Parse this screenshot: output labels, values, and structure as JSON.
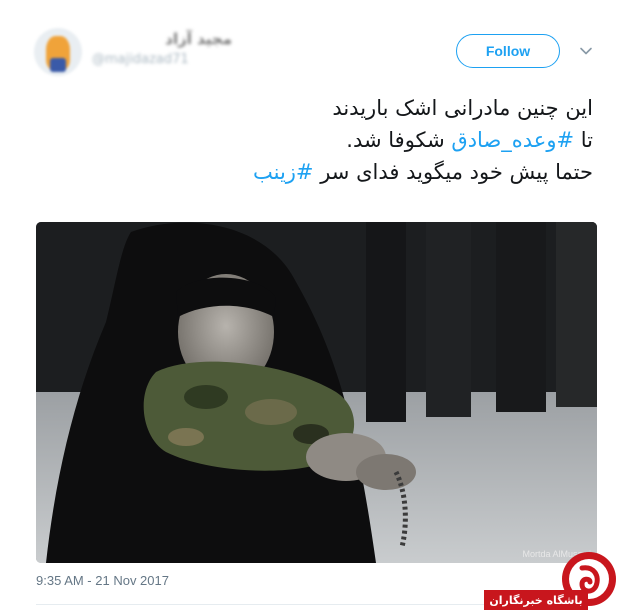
{
  "tweet": {
    "display_name": "مجید آزاد",
    "handle": "@majidazad71",
    "follow_label": "Follow",
    "text_line1": "این چنین مادرانی اشک باریدند",
    "text_line2_prefix": "تا ",
    "text_line2_hashtag": "#وعده_صادق",
    "text_line2_suffix": " شکوفا شد.",
    "text_line3_prefix": "حتما پیش خود میگوید فدای سر ",
    "text_line3_hashtag": "#زینب",
    "photo_credit": "Mortda AlMusawi",
    "timestamp": "9:35 AM - 21 Nov 2017"
  },
  "watermark": {
    "banner_text": "باشگاه خبرنگاران",
    "brand_color": "#c8161d"
  },
  "colors": {
    "link": "#1da1f2",
    "muted": "#657786"
  },
  "icons": {
    "chevron": "chevron-down-icon",
    "logo": "watermark-logo-icon"
  }
}
